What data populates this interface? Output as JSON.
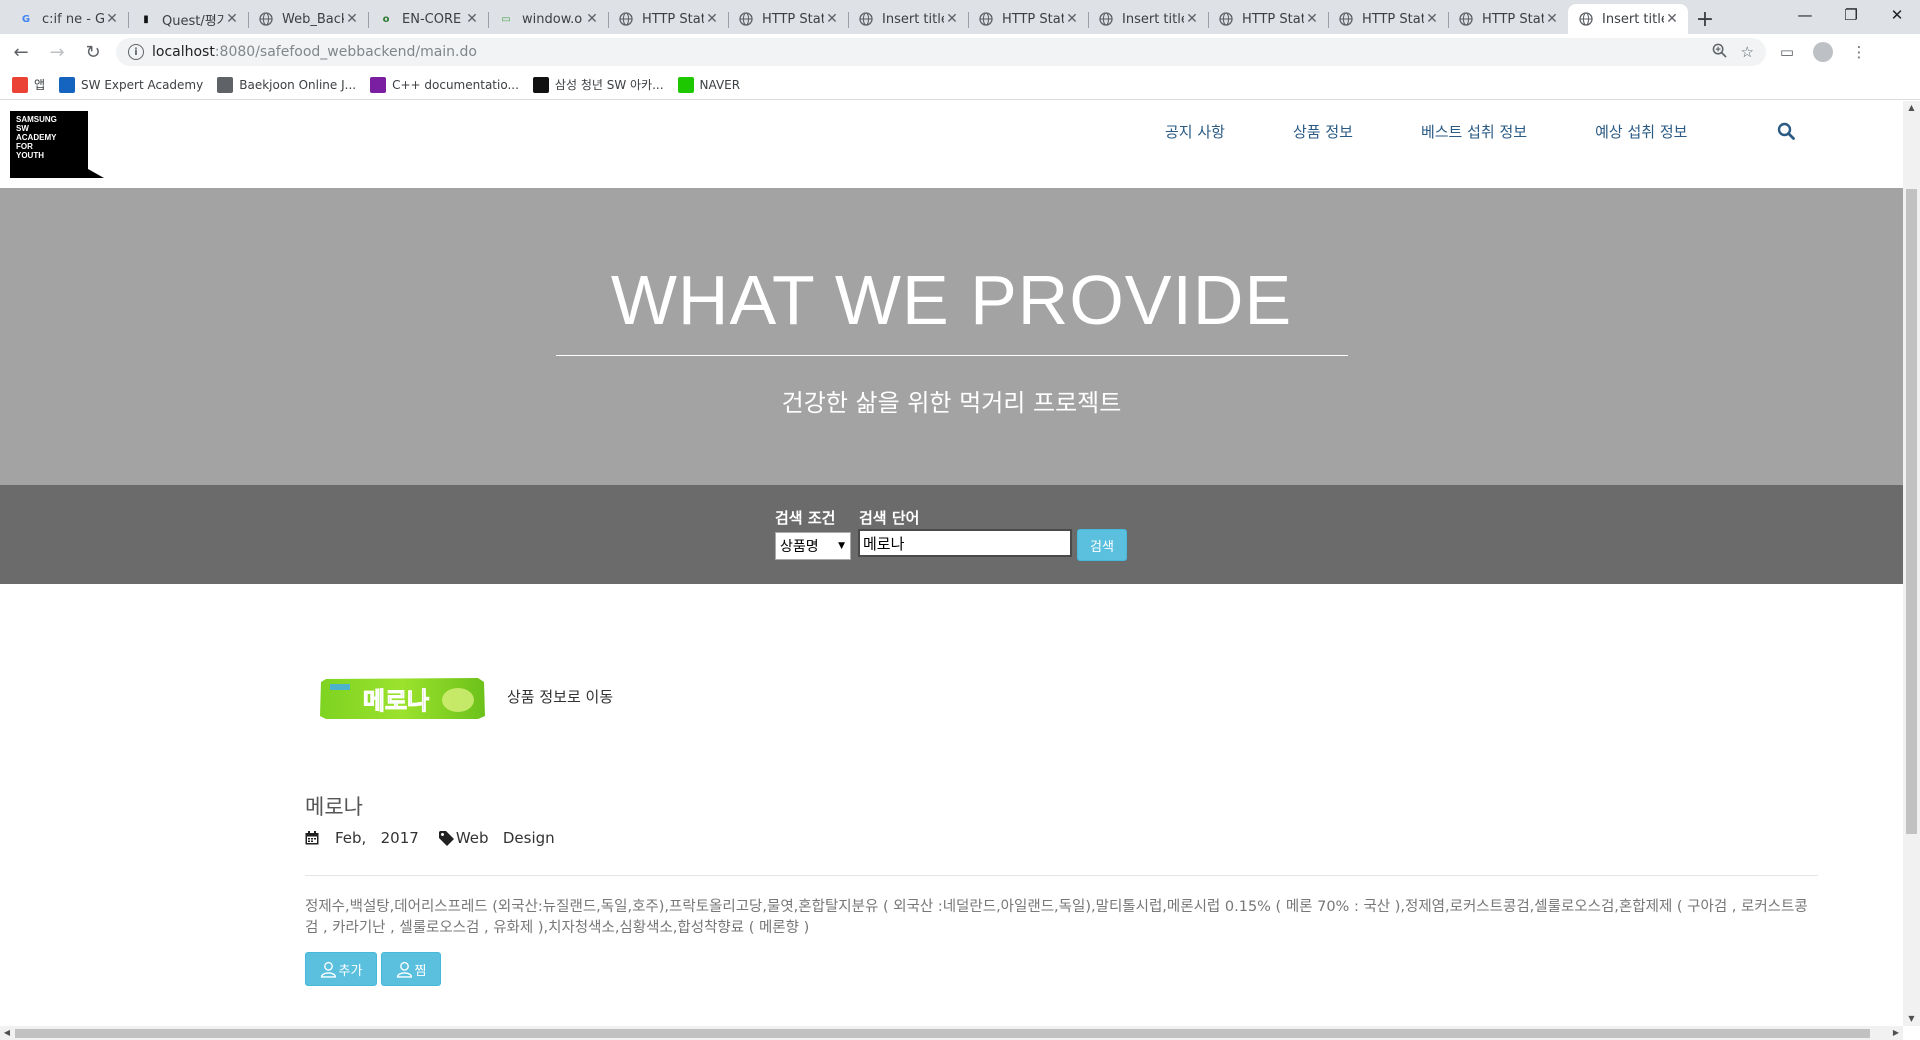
{
  "browser": {
    "tabs": [
      {
        "title": "c:if ne - G",
        "favicon": "google-g-icon",
        "color": "#4285f4",
        "glyph": "G"
      },
      {
        "title": "Quest/평가",
        "favicon": "quest-logo-icon",
        "color": "#111111",
        "glyph": "▮"
      },
      {
        "title": "Web_Back",
        "favicon": "globe-icon",
        "color": "#5f6368",
        "glyph": ""
      },
      {
        "title": "EN-CORE",
        "favicon": "encore-logo-icon",
        "color": "#2e7d32",
        "glyph": "o"
      },
      {
        "title": "window.o",
        "favicon": "sample-logo-icon",
        "color": "#43a047",
        "glyph": "▭"
      },
      {
        "title": "HTTP Stat",
        "favicon": "globe-icon",
        "color": "#5f6368",
        "glyph": ""
      },
      {
        "title": "HTTP Stat",
        "favicon": "globe-icon",
        "color": "#5f6368",
        "glyph": ""
      },
      {
        "title": "Insert title",
        "favicon": "globe-icon",
        "color": "#5f6368",
        "glyph": ""
      },
      {
        "title": "HTTP Stat",
        "favicon": "globe-icon",
        "color": "#5f6368",
        "glyph": ""
      },
      {
        "title": "Insert title",
        "favicon": "globe-icon",
        "color": "#5f6368",
        "glyph": ""
      },
      {
        "title": "HTTP Stat",
        "favicon": "globe-icon",
        "color": "#5f6368",
        "glyph": ""
      },
      {
        "title": "HTTP Stat",
        "favicon": "globe-icon",
        "color": "#5f6368",
        "glyph": ""
      },
      {
        "title": "HTTP Stat",
        "favicon": "globe-icon",
        "color": "#5f6368",
        "glyph": ""
      },
      {
        "title": "Insert title",
        "favicon": "globe-icon",
        "color": "#5f6368",
        "glyph": "",
        "active": true
      }
    ],
    "url_host": "localhost",
    "url_path": ":8080/safefood_webbackend/main.do",
    "bookmarks": [
      {
        "label": "앱",
        "icon": "apps-grid-icon",
        "color": "#ea4335"
      },
      {
        "label": "SW Expert Academy",
        "icon": "swea-logo-icon",
        "color": "#1565c0"
      },
      {
        "label": "Baekjoon Online J...",
        "icon": "code-brackets-icon",
        "color": "#5f6368"
      },
      {
        "label": "C++ documentatio...",
        "icon": "cpp-doc-icon",
        "color": "#7b1fa2"
      },
      {
        "label": "삼성 청년 SW 아카...",
        "icon": "ssafy-logo-icon",
        "color": "#111111"
      },
      {
        "label": "NAVER",
        "icon": "naver-logo-icon",
        "color": "#1ec800"
      }
    ]
  },
  "site": {
    "logo_lines": [
      "SAMSUNG",
      "SW",
      "ACADEMY",
      "FOR",
      "YOUTH"
    ],
    "nav": [
      "공지 사항",
      "상품 정보",
      "베스트 섭취 정보",
      "예상 섭취 정보"
    ],
    "accent_color": "#2b5b84"
  },
  "hero": {
    "title": "WHAT WE PROVIDE",
    "subtitle": "건강한 삶을 위한 먹거리 프로젝트"
  },
  "search": {
    "condition_label": "검색 조건",
    "keyword_label": "검색 단어",
    "condition_selected": "상품명",
    "keyword_value": "메로나",
    "button_label": "검색"
  },
  "product": {
    "image_text": "메로나",
    "link_label": "상품 정보로 이동",
    "name": "메로나",
    "date_month": "Feb,",
    "date_year": "2017",
    "tags": [
      "Web",
      "Design"
    ],
    "ingredients": "정제수,백설탕,데어리스프레드 (외국산:뉴질랜드,독일,호주),프락토올리고당,물엿,혼합탈지분유 ( 외국산 :네덜란드,아일랜드,독일),말티톨시럽,메론시럽 0.15% ( 메론 70% : 국산 ),정제염,로커스트콩검,셀룰로오스검,혼합제제 ( 구아검 , 로커스트콩검 , 카라기난 , 셀룰로오스검 , 유화제 ),치자청색소,심황색소,합성착향료 ( 메론향 )",
    "add_button": "추가",
    "wish_button": "찜",
    "button_color": "#5bc0de"
  }
}
